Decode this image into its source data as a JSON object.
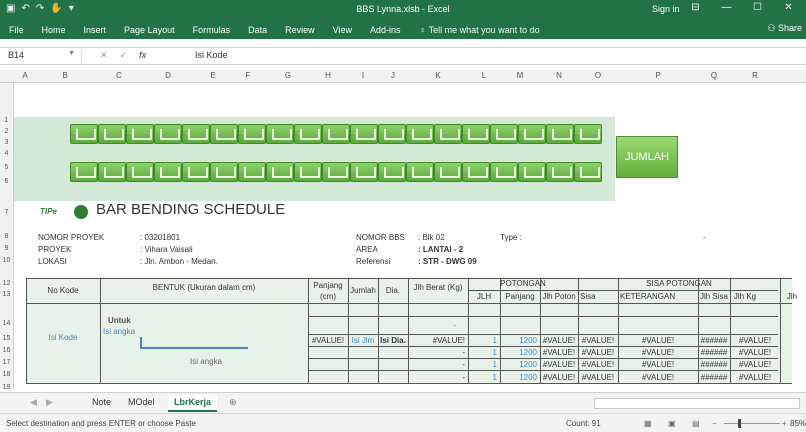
{
  "window": {
    "title": "BBS Lynna.xlsb - Excel",
    "sign_in": "Sign in",
    "share": "Share"
  },
  "ribbon": {
    "tabs": [
      "File",
      "Home",
      "Insert",
      "Page Layout",
      "Formulas",
      "Data",
      "Review",
      "View",
      "Add-ins"
    ],
    "tell_me": "Tell me what you want to do"
  },
  "formula_bar": {
    "name_box": "B14",
    "fx": "fx",
    "content": "Isi Kode"
  },
  "columns": [
    "A",
    "B",
    "C",
    "D",
    "E",
    "F",
    "G",
    "H",
    "I",
    "J",
    "K",
    "L",
    "M",
    "N",
    "O",
    "P",
    "Q",
    "R"
  ],
  "rows": [
    "1",
    "2",
    "3",
    "4",
    "5",
    "6",
    "7",
    "8",
    "9",
    "10",
    "12",
    "13",
    "14",
    "15",
    "16",
    "17",
    "18",
    "19"
  ],
  "sheet": {
    "jumlah": "JUMLAH",
    "logo_text": "TIPe",
    "title": "BAR BENDING SCHEDULE",
    "info_left": [
      {
        "label": "NOMOR PROYEK",
        "value": ": 03201801"
      },
      {
        "label": "PROYEK",
        "value": ": Vihara Vaisali"
      },
      {
        "label": "LOKASI",
        "value": ": Jln. Ambon - Medan."
      }
    ],
    "info_right": [
      {
        "label": "NOMOR BBS",
        "value": ": Blk 02"
      },
      {
        "label": "AREA",
        "value": ": LANTAI - 2"
      },
      {
        "label": "Referensi",
        "value": ": STR - DWG 09"
      }
    ],
    "type_label": "Type :",
    "type_dash": "-",
    "headers": {
      "no_kode": "No Kode",
      "bentuk": "BENTUK (Ukuran dalam cm)",
      "panjang": "Panjang (cm)",
      "jumlah": "Jumlah",
      "dia": "Dia.",
      "berat": "Jlh Berat (Kg)",
      "potongan": "POTONGAN",
      "jlh": "JLH",
      "panjang2": "Panjang",
      "jlh_poton": "Jlh Poton",
      "sisa": "Sisa",
      "sisa_potongan": "SISA POTONGAN",
      "keterangan": "KETERANGAN",
      "jlh_sisa": "Jlh Sisa",
      "jlh_kg": "Jlh Kg",
      "jlh_extra": "Jlh"
    },
    "body": {
      "isi_kode": "Isi Kode",
      "untuk": "Untuk",
      "isi_angka_top": "Isi angka",
      "isi_angka_bottom": "Isi angka",
      "dash_row14": "-"
    },
    "rows": [
      {
        "panjang": "#VALUE!",
        "jumlah": "Isi Jlm",
        "dia": "Isi Dia.",
        "berat": "#VALUE!",
        "jlh": "1",
        "panjang2": "1200",
        "jlh_poton": "#VALUE!",
        "sisa": "#VALUE!",
        "ket": "#VALUE!",
        "jlh_sisa": "######",
        "jlh_kg": "#VALUE!"
      },
      {
        "panjang": "",
        "jumlah": "",
        "dia": "",
        "berat": "-",
        "jlh": "1",
        "panjang2": "1200",
        "jlh_poton": "#VALUE!",
        "sisa": "#VALUE!",
        "ket": "#VALUE!",
        "jlh_sisa": "######",
        "jlh_kg": "#VALUE!"
      },
      {
        "panjang": "",
        "jumlah": "",
        "dia": "",
        "berat": "-",
        "jlh": "1",
        "panjang2": "1200",
        "jlh_poton": "#VALUE!",
        "sisa": "#VALUE!",
        "ket": "#VALUE!",
        "jlh_sisa": "######",
        "jlh_kg": "#VALUE!"
      },
      {
        "panjang": "",
        "jumlah": "",
        "dia": "",
        "berat": "-",
        "jlh": "1",
        "panjang2": "1200",
        "jlh_poton": "#VALUE!",
        "sisa": "#VALUE!",
        "ket": "#VALUE!",
        "jlh_sisa": "######",
        "jlh_kg": "#VALUE!"
      }
    ]
  },
  "sheet_tabs": [
    "Note",
    "MOdel",
    "LbrKerja"
  ],
  "status": {
    "message": "Select destination and press ENTER or choose Paste",
    "count": "Count: 91",
    "zoom": "85%"
  }
}
